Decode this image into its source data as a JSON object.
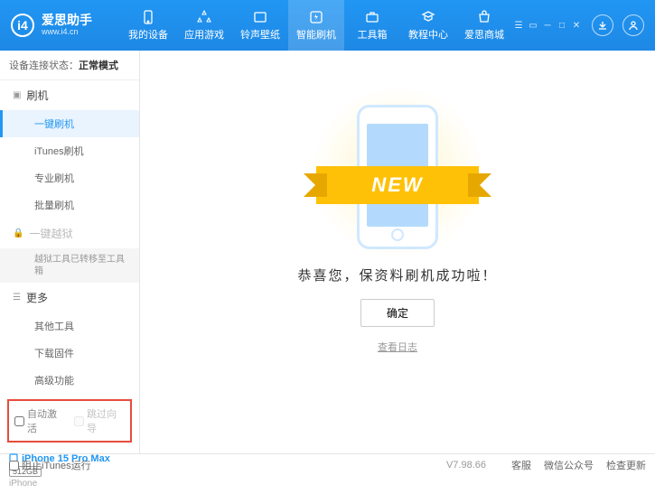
{
  "header": {
    "logo_title": "爱思助手",
    "logo_url": "www.i4.cn",
    "tabs": [
      {
        "label": "我的设备"
      },
      {
        "label": "应用游戏"
      },
      {
        "label": "铃声壁纸"
      },
      {
        "label": "智能刷机"
      },
      {
        "label": "工具箱"
      },
      {
        "label": "教程中心"
      },
      {
        "label": "爱思商城"
      }
    ]
  },
  "sidebar": {
    "status_label": "设备连接状态：",
    "status_value": "正常模式",
    "group_flash": "刷机",
    "items_flash": [
      "一键刷机",
      "iTunes刷机",
      "专业刷机",
      "批量刷机"
    ],
    "group_jailbreak": "一键越狱",
    "jailbreak_note": "越狱工具已转移至工具箱",
    "group_more": "更多",
    "items_more": [
      "其他工具",
      "下载固件",
      "高级功能"
    ],
    "cb_auto_activate": "自动激活",
    "cb_skip_guide": "跳过向导",
    "device_name": "iPhone 15 Pro Max",
    "device_storage": "512GB",
    "device_type": "iPhone"
  },
  "main": {
    "ribbon_text": "NEW",
    "success_message": "恭喜您，保资料刷机成功啦！",
    "ok_button": "确定",
    "view_log": "查看日志"
  },
  "footer": {
    "block_itunes": "阻止iTunes运行",
    "version": "V7.98.66",
    "links": [
      "客服",
      "微信公众号",
      "检查更新"
    ]
  }
}
